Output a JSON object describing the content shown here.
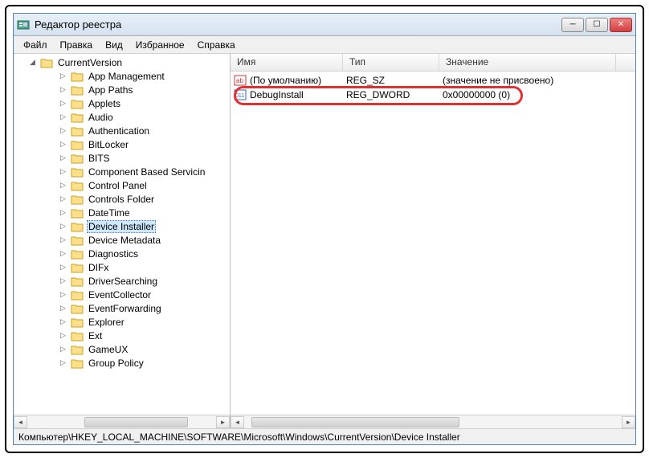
{
  "window": {
    "title": "Редактор реестра"
  },
  "menu": {
    "file": "Файл",
    "edit": "Правка",
    "view": "Вид",
    "favorites": "Избранное",
    "help": "Справка"
  },
  "tree": {
    "root": "CurrentVersion",
    "items": [
      "App Management",
      "App Paths",
      "Applets",
      "Audio",
      "Authentication",
      "BitLocker",
      "BITS",
      "Component Based Servicin",
      "Control Panel",
      "Controls Folder",
      "DateTime",
      "Device Installer",
      "Device Metadata",
      "Diagnostics",
      "DIFx",
      "DriverSearching",
      "EventCollector",
      "EventForwarding",
      "Explorer",
      "Ext",
      "GameUX",
      "Group Policy"
    ],
    "selected_index": 11
  },
  "list": {
    "columns": {
      "name": "Имя",
      "type": "Тип",
      "data": "Значение"
    },
    "rows": [
      {
        "icon": "ab",
        "name": "(По умолчанию)",
        "type": "REG_SZ",
        "data": "(значение не присвоено)"
      },
      {
        "icon": "bin",
        "name": "DebugInstall",
        "type": "REG_DWORD",
        "data": "0x00000000 (0)"
      }
    ]
  },
  "statusbar": {
    "path": "Компьютер\\HKEY_LOCAL_MACHINE\\SOFTWARE\\Microsoft\\Windows\\CurrentVersion\\Device Installer"
  },
  "col_widths": {
    "name": 140,
    "type": 120,
    "data": 220
  }
}
